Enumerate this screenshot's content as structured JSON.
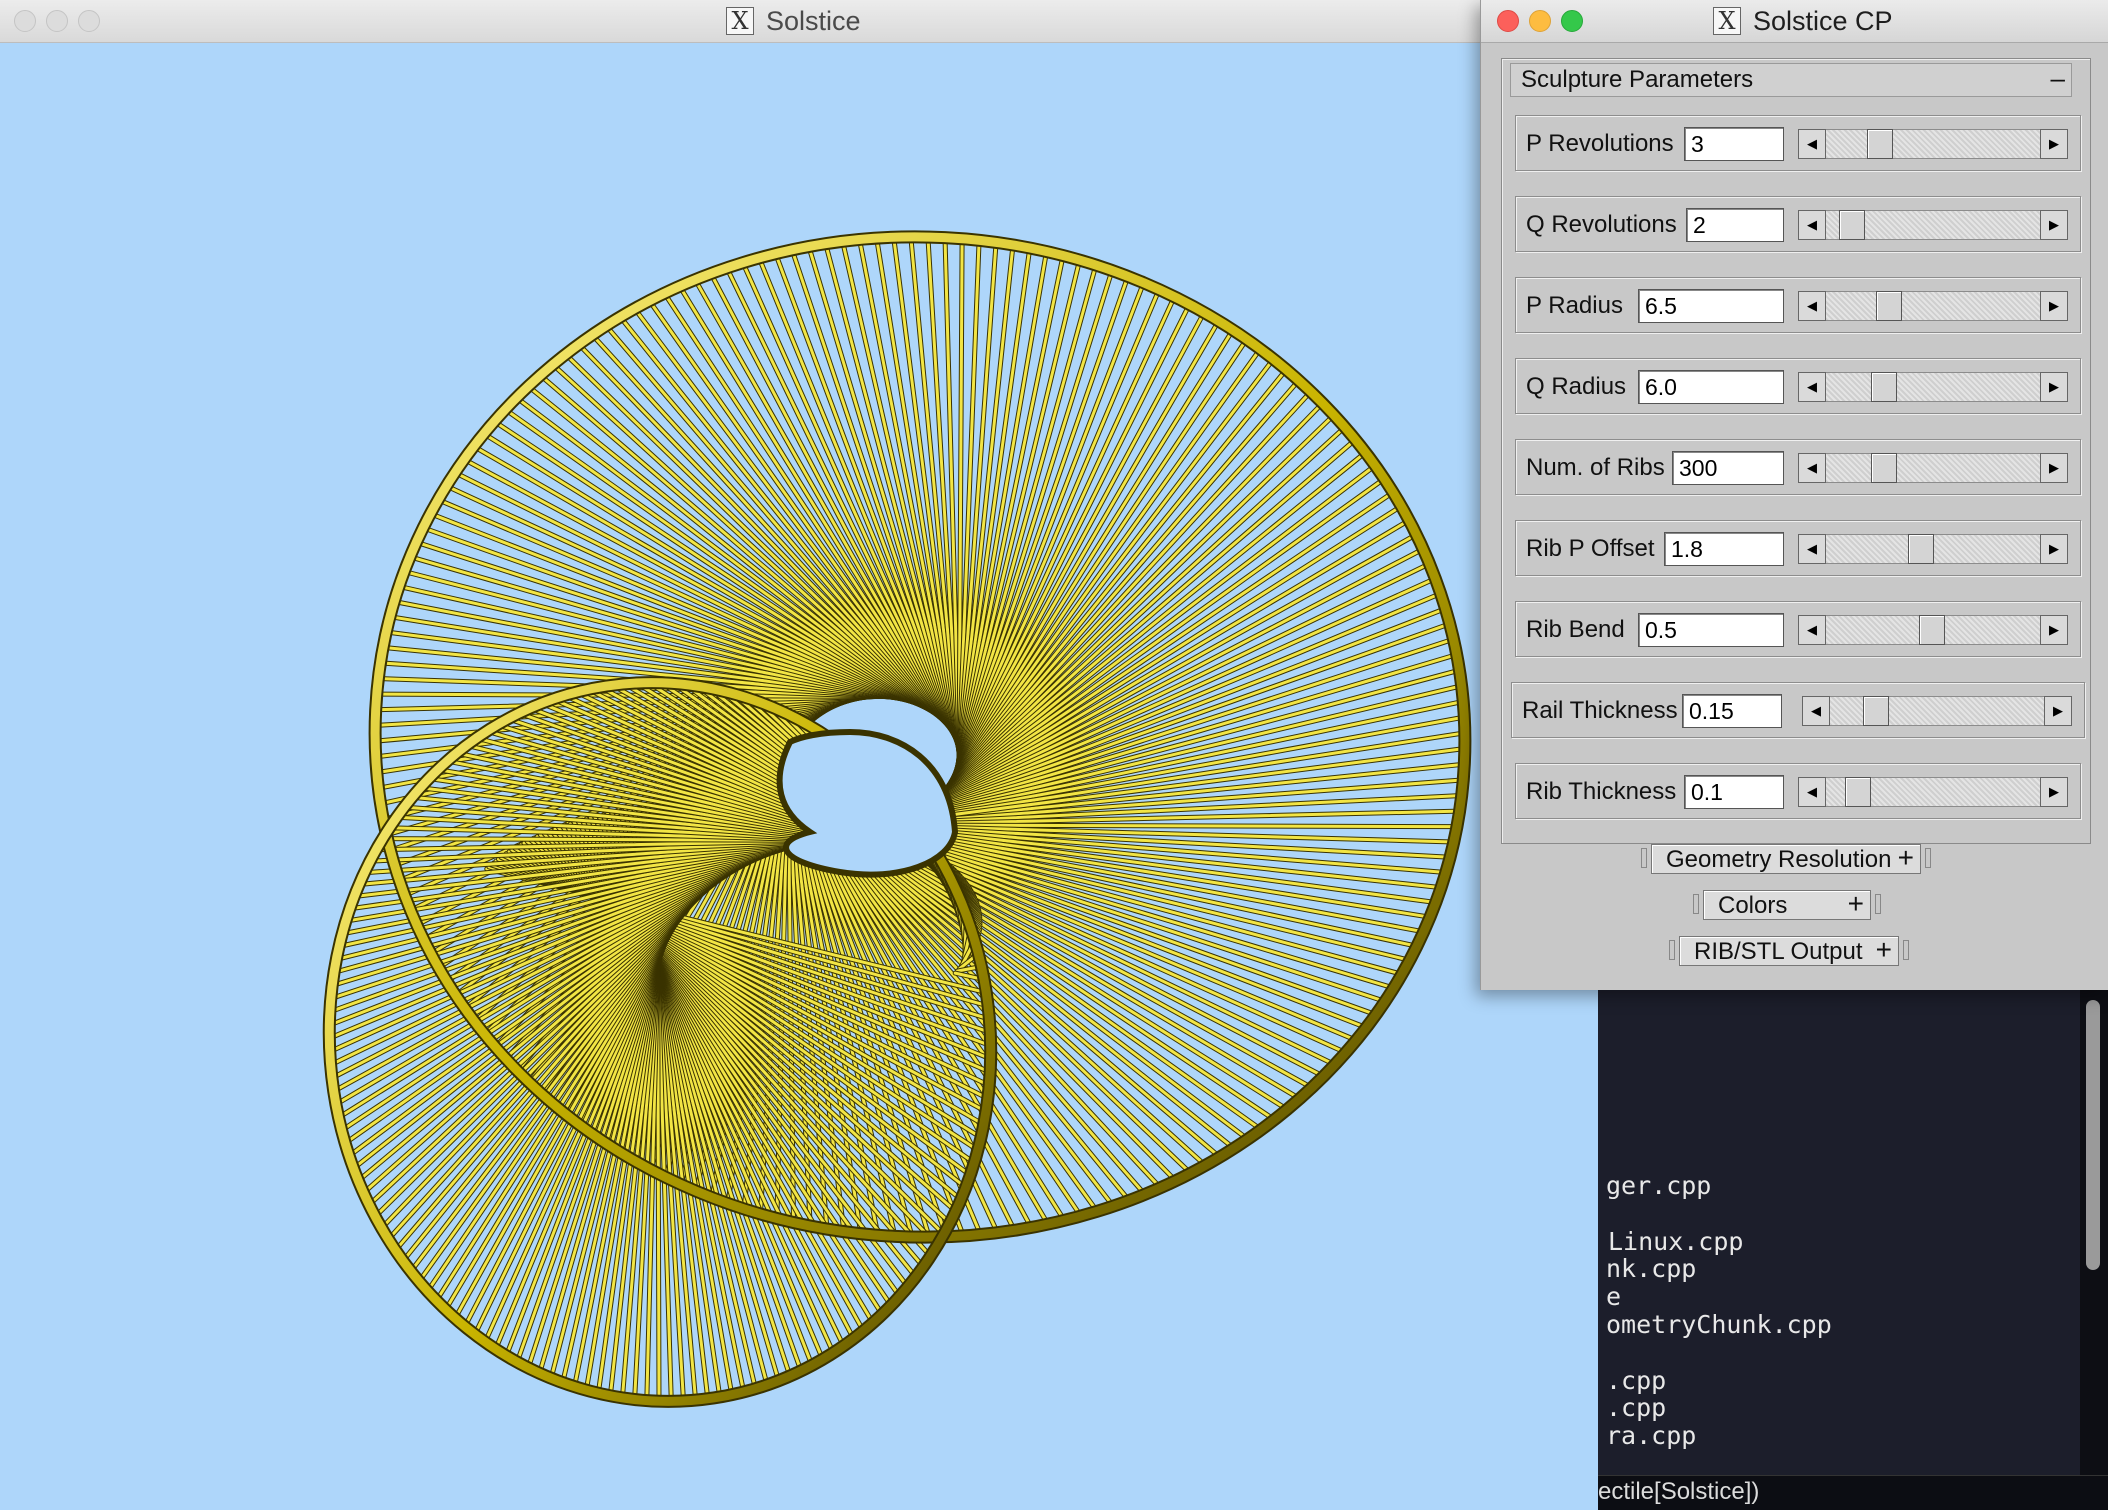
{
  "main_window": {
    "title": "Solstice"
  },
  "control_panel": {
    "title": "Solstice CP",
    "group_title": "Sculpture Parameters",
    "collapse_symbol": "–",
    "params": [
      {
        "label": "P Revolutions",
        "value": "3"
      },
      {
        "label": "Q Revolutions",
        "value": "2"
      },
      {
        "label": "P Radius",
        "value": "6.5"
      },
      {
        "label": "Q Radius",
        "value": "6.0"
      },
      {
        "label": "Num. of Ribs",
        "value": "300"
      },
      {
        "label": "Rib P Offset",
        "value": "1.8"
      },
      {
        "label": "Rib Bend",
        "value": "0.5"
      },
      {
        "label": "Rail Thickness",
        "value": "0.15"
      },
      {
        "label": "Rib Thickness",
        "value": "0.1"
      }
    ],
    "sections": [
      {
        "label": "Geometry Resolution",
        "symbol": "+"
      },
      {
        "label": "Colors",
        "symbol": "+"
      },
      {
        "label": "RIB/STL Output",
        "symbol": "+"
      }
    ]
  },
  "terminal": {
    "lines": [
      "ger.cpp",
      "Linux.cpp",
      "nk.cpp",
      "e",
      "ometryChunk.cpp",
      "",
      ".cpp",
      ".cpp",
      "ra.cpp"
    ],
    "status": "ectile[Solstice])"
  },
  "colors": {
    "sky": "#aed6fa",
    "sculpture": "#f2e544",
    "sculpture_dark": "#3a3300"
  }
}
